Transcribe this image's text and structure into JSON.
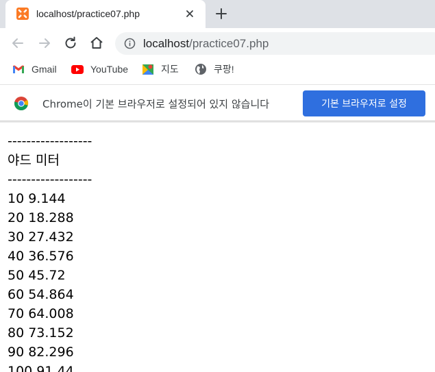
{
  "tab": {
    "title": "localhost/practice07.php",
    "close_icon": "close-icon",
    "favicon": "xampp-icon"
  },
  "new_tab_icon": "plus-icon",
  "toolbar": {
    "back_icon": "arrow-left-icon",
    "forward_icon": "arrow-right-icon",
    "reload_icon": "reload-icon",
    "home_icon": "home-icon",
    "info_icon": "info-icon",
    "url_host": "localhost",
    "url_path": "/practice07.php"
  },
  "bookmarks": [
    {
      "label": "Gmail",
      "icon": "gmail-icon"
    },
    {
      "label": "YouTube",
      "icon": "youtube-icon"
    },
    {
      "label": "지도",
      "icon": "maps-icon"
    },
    {
      "label": "쿠팡!",
      "icon": "globe-icon"
    }
  ],
  "infobar": {
    "message": "Chrome이 기본 브라우저로 설정되어 있지 않습니다",
    "button_label": "기본 브라우저로 설정",
    "button_color": "#2f6fdf"
  },
  "content": {
    "divider_top": "------------------",
    "header": "야드 미터",
    "divider_bottom": "------------------",
    "rows": [
      "10 9.144",
      "20 18.288",
      "30 27.432",
      "40 36.576",
      "50 45.72",
      "60 54.864",
      "70 64.008",
      "80 73.152",
      "90 82.296",
      "100 91.44"
    ]
  }
}
